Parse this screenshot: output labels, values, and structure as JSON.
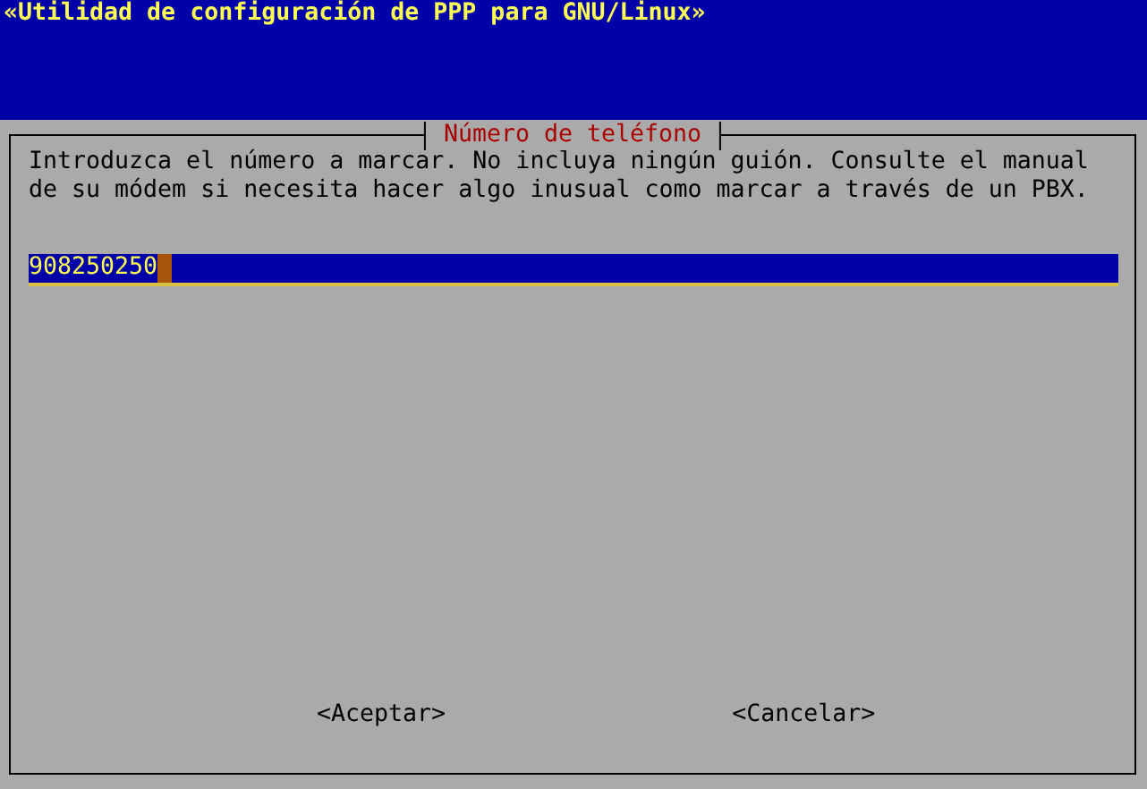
{
  "backtitle": "«Utilidad de configuración de PPP para GNU/Linux»",
  "dialog": {
    "title": "Número de teléfono",
    "message_lines": [
      "Introduzca el número a marcar. No incluya ningún guión. Consulte el manual",
      "de su módem si necesita hacer algo inusual como marcar a través de un PBX."
    ],
    "input": {
      "value": "908250250"
    },
    "buttons": [
      {
        "label": "<Aceptar>"
      },
      {
        "label": "<Cancelar>"
      }
    ]
  }
}
